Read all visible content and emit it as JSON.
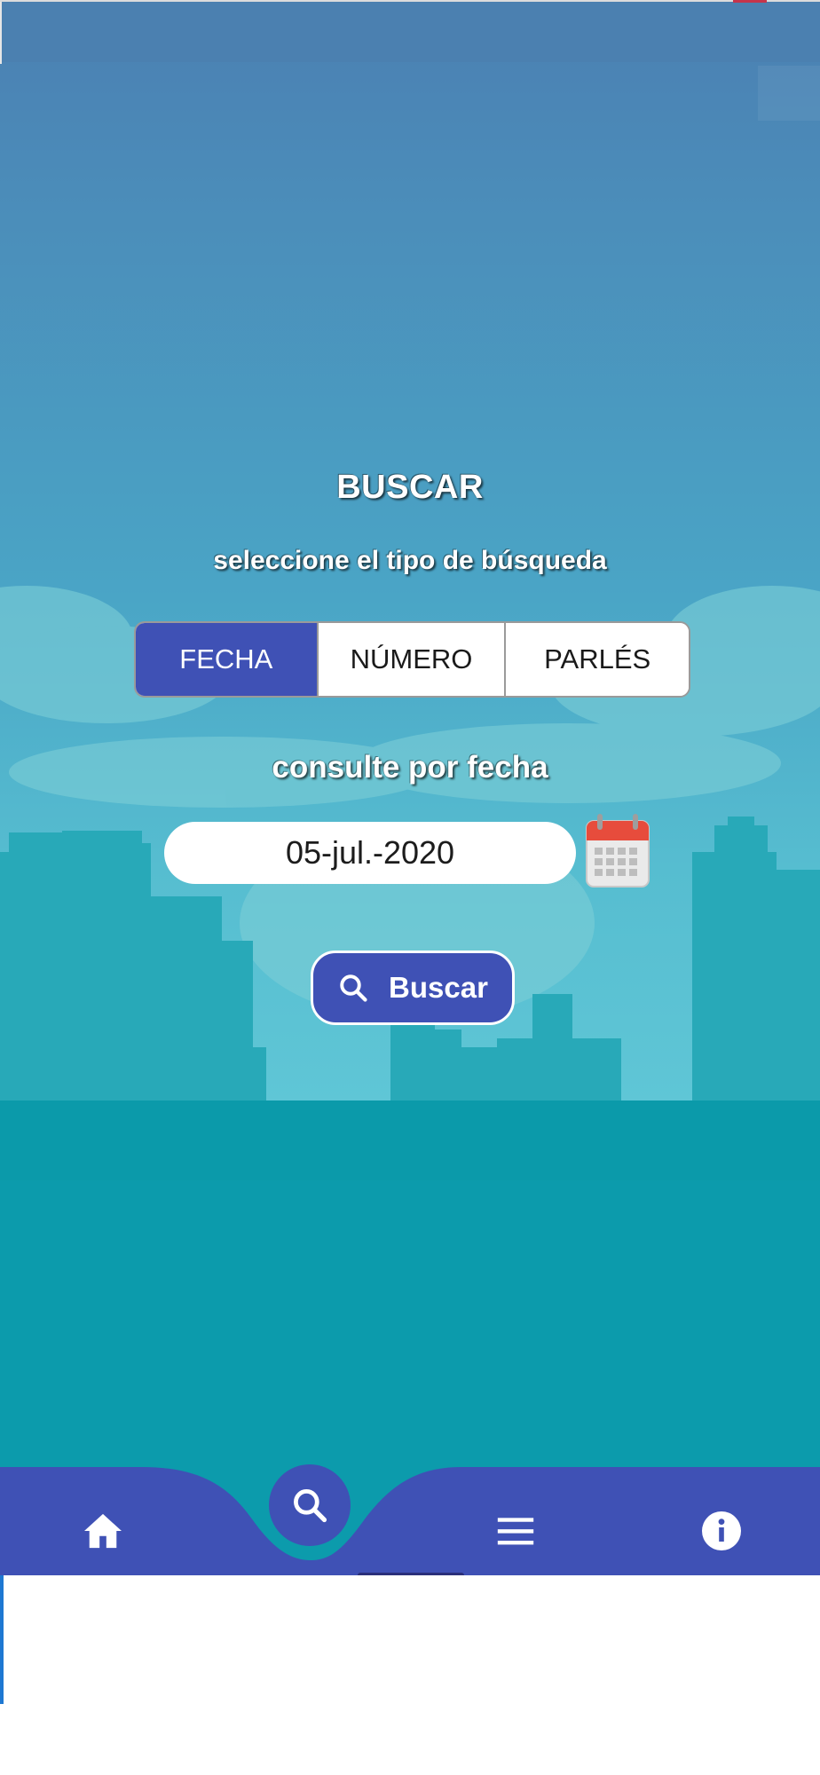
{
  "screen": {
    "title": "BUSCAR",
    "subtitle": "seleccione el tipo de búsqueda",
    "search_type": {
      "options": [
        "FECHA",
        "NÚMERO",
        "PARLÉS"
      ],
      "selected": "FECHA"
    },
    "date_section_label": "consulte por fecha",
    "date_value": "05-jul.-2020",
    "search_button_label": "Buscar"
  },
  "bottom_nav": {
    "items": [
      {
        "name": "home",
        "icon": "home-icon"
      },
      {
        "name": "search",
        "icon": "search-icon",
        "active": true
      },
      {
        "name": "menu",
        "icon": "menu-icon"
      },
      {
        "name": "info",
        "icon": "info-icon"
      }
    ]
  },
  "colors": {
    "accent": "#3f51b5",
    "sky_top": "#4b7fb2",
    "sky_bottom": "#5fc6d6",
    "city": "#0e9aa8",
    "calendar_red": "#e74c3c"
  }
}
